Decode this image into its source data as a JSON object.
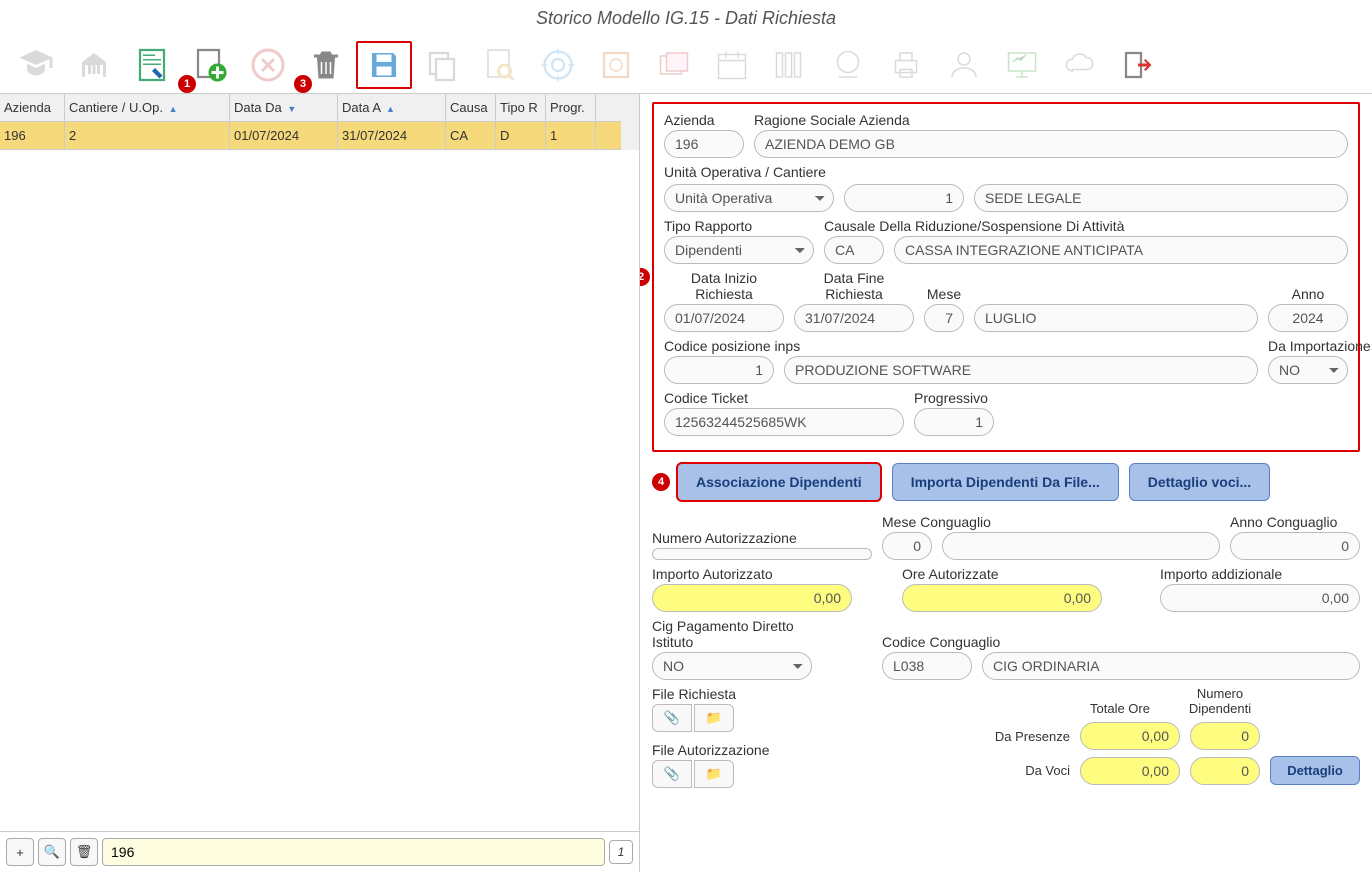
{
  "title": "Storico Modello IG.15 - Dati Richiesta",
  "badges": {
    "b1": "1",
    "b3": "3",
    "b2": "2",
    "b4": "4"
  },
  "grid": {
    "headers": {
      "azienda": "Azienda",
      "cantiere": "Cantiere / U.Op.",
      "dataDa": "Data Da",
      "dataA": "Data A",
      "causa": "Causa",
      "tipo": "Tipo R",
      "progr": "Progr."
    },
    "row": {
      "azienda": "196",
      "cantiere": "2",
      "dataDa": "01/07/2024",
      "dataA": "31/07/2024",
      "causa": "CA",
      "tipo": "D",
      "progr": "1"
    }
  },
  "search": {
    "value": "196",
    "page": "1"
  },
  "form": {
    "labels": {
      "azienda": "Azienda",
      "ragione": "Ragione Sociale Azienda",
      "unita": "Unità Operativa / Cantiere",
      "tipoRapporto": "Tipo Rapporto",
      "causale": "Causale Della Riduzione/Sospensione Di Attività",
      "dataInizio": "Data Inizio Richiesta",
      "dataFine": "Data Fine Richiesta",
      "mese": "Mese",
      "anno": "Anno",
      "codInps": "Codice posizione inps",
      "daImport": "Da Importazione",
      "codTicket": "Codice Ticket",
      "progressivo": "Progressivo",
      "numAuth": "Numero Autorizzazione",
      "meseCong": "Mese Conguaglio",
      "annoCong": "Anno Conguaglio",
      "impAuth": "Importo Autorizzato",
      "oreAuth": "Ore Autorizzate",
      "impAdd": "Importo addizionale",
      "cigPag": "Cig Pagamento Diretto Istituto",
      "codCong": "Codice Conguaglio",
      "fileRich": "File Richiesta",
      "fileAuth": "File Autorizzazione",
      "totOre": "Totale Ore",
      "numDip": "Numero Dipendenti",
      "daPresenze": "Da Presenze",
      "daVoci": "Da Voci"
    },
    "values": {
      "azienda": "196",
      "ragione": "AZIENDA DEMO GB",
      "unitaSel": "Unità Operativa",
      "unitaCode": "1",
      "unitaDesc": "SEDE LEGALE",
      "tipoRapporto": "Dipendenti",
      "causaleCode": "CA",
      "causaleDesc": "CASSA INTEGRAZIONE ANTICIPATA",
      "dataInizio": "01/07/2024",
      "dataFine": "31/07/2024",
      "mese": "7",
      "meseDesc": "LUGLIO",
      "anno": "2024",
      "codInps": "1",
      "codInpsDesc": "PRODUZIONE SOFTWARE",
      "daImport": "NO",
      "codTicket": "12563244525685WK",
      "progressivo": "1",
      "numAuth": "",
      "meseCongN": "0",
      "meseCongDesc": "",
      "annoCong": "0",
      "impAuth": "0,00",
      "oreAuth": "0,00",
      "impAdd": "0,00",
      "cigPag": "NO",
      "codCongCode": "L038",
      "codCongDesc": "CIG ORDINARIA",
      "presOre": "0,00",
      "presDip": "0",
      "vociOre": "0,00",
      "vociDip": "0"
    }
  },
  "buttons": {
    "assoc": "Associazione Dipendenti",
    "importa": "Importa Dipendenti Da File...",
    "dettaglio": "Dettaglio voci...",
    "dettaglioSm": "Dettaglio"
  }
}
